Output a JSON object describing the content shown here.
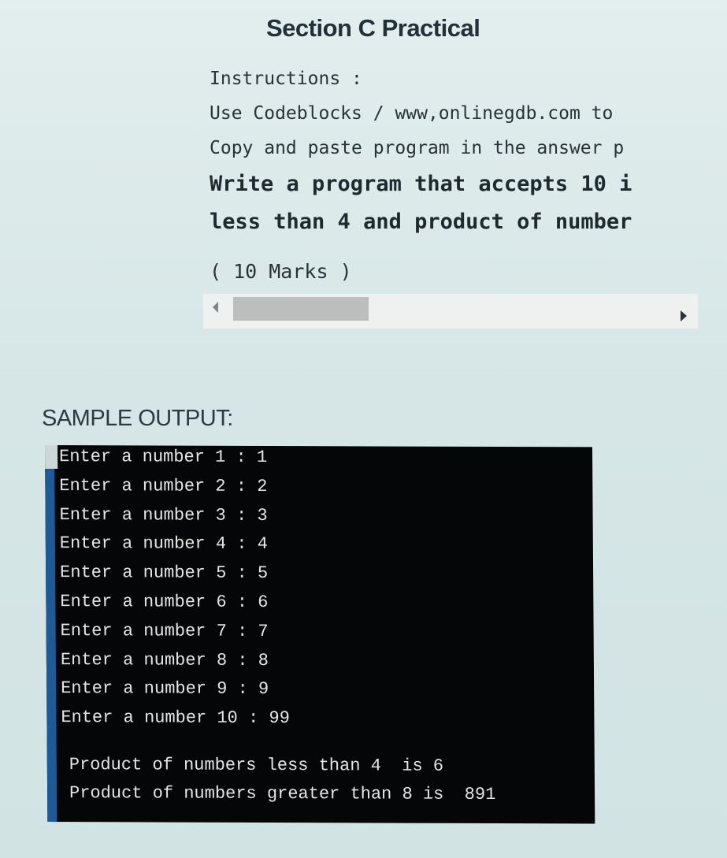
{
  "section": {
    "title": "Section C Practical"
  },
  "question": {
    "instructions_label": "Instructions :",
    "instruction_lines": [
      "Use Codeblocks / www,onlinegdb.com to",
      "Copy and paste program in the answer p"
    ],
    "prompt_lines": [
      "Write a program that accepts 10 i",
      "less than 4 and product of number"
    ],
    "marks": "( 10 Marks )"
  },
  "scrollbar": {
    "orientation": "horizontal",
    "position_fraction": 0.0,
    "visible_fraction": 0.3
  },
  "sample_output": {
    "label": "SAMPLE OUTPUT:",
    "inputs": [
      {
        "prompt": "Enter a number 1 :",
        "value": "1"
      },
      {
        "prompt": "Enter a number 2 :",
        "value": "2"
      },
      {
        "prompt": "Enter a number 3 :",
        "value": "3"
      },
      {
        "prompt": "Enter a number 4 :",
        "value": "4"
      },
      {
        "prompt": "Enter a number 5 :",
        "value": "5"
      },
      {
        "prompt": "Enter a number 6 :",
        "value": "6"
      },
      {
        "prompt": "Enter a number 7 :",
        "value": "7"
      },
      {
        "prompt": "Enter a number 8 :",
        "value": "8"
      },
      {
        "prompt": "Enter a number 9 :",
        "value": "9"
      },
      {
        "prompt": "Enter a number 10 :",
        "value": "99"
      }
    ],
    "results": [
      "Product of numbers less than 4  is 6",
      "Product of numbers greater than 8 is  891"
    ]
  }
}
